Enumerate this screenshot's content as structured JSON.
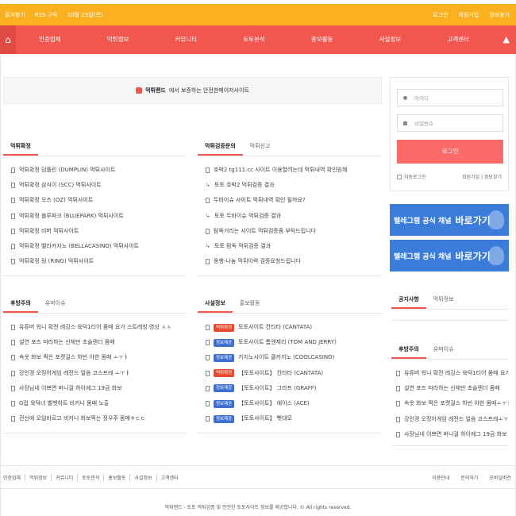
{
  "topbar": {
    "left": [
      "즐겨찾기",
      "RSS 구독",
      "10월 23일(목)"
    ],
    "right": [
      "로그인",
      "회원가입",
      "정보찾기"
    ]
  },
  "nav": {
    "items": [
      "인증업체",
      "먹튀정보",
      "커뮤니티",
      "토토분석",
      "홍보활동",
      "사설정보",
      "고객센터"
    ]
  },
  "banner": {
    "brand": "먹튀랜드",
    "text": "에서 보증하는 안전한메이저사이트"
  },
  "box1": {
    "tabs": [
      "먹튀확정"
    ],
    "items": [
      "먹튀확정 덤플린 (DUMPLIN) 먹튀사이트",
      "먹튀확정 삼식이 (SCC) 먹튀사이트",
      "먹튀확정 오즈 (OZ) 먹튀사이트",
      "먹튀확정 블루파크 (BLUEPARK) 먹튀사이트",
      "먹튀확정 비버 먹튀사이트",
      "먹튀확정 벨라카지노 (BELLACASINO) 먹튀사이트",
      "먹튀확정 링 (RING) 먹튀사이트"
    ]
  },
  "box2": {
    "tabs": [
      "먹튀검증문의",
      "먹튀신고"
    ],
    "items": [
      "호박2 tg111.cc 사이트 이용할려는데 먹튀내역 확인원해",
      "토토 호박2 먹튀검증 결과",
      "두바이슈 사이트 먹튀내역 확인 될까요?",
      "토토 두바이슈 먹튀검증 결과",
      "탐독거리는 사이트 먹튀검증좀 부탁드립니다",
      "토토 탐독 먹튀검증 결과",
      "동행-나눔 먹튀이력 검증요청드립니다"
    ]
  },
  "box3": {
    "tabs": [
      "후방주의",
      "유머이슈"
    ],
    "items": [
      "유튜버 워니 확전 레깅스 육덕1티어 몸매 요가 스트레칭 영상 ㅅㅅ",
      "설연 포즈 따라하는 신체만 초슬렌더 몸매",
      "속옷 화보 찍은 포켓걸스 하빈 야한 몸매 ㅗㅜㅑ",
      "강인경 오징어게임 레전드 얼음 코스프레 ㅗㅜㅑ",
      "사장님네 이쁘면 버니걸 하이에그 19금 화보",
      "G컵 육덕녀 벨벳하트 비키니 몸매 노출",
      "전신에 오일바르고 비키니 화보찍는 정우주 몸매ㅎㄷㄷ"
    ]
  },
  "box4": {
    "tabs": [
      "사설정보",
      "홍보활동"
    ],
    "items": [
      {
        "badge": "먹튀확정",
        "color": "red",
        "text": "토토사이트 칸타타 (CANTATA)"
      },
      {
        "badge": "정보제공",
        "color": "blue",
        "text": "토토사이트 톰앤제리 (TOM AND JERRY)"
      },
      {
        "badge": "정보제공",
        "color": "blue",
        "text": "카지노사이트 쿨카지노 (COOLCASINO)"
      },
      {
        "badge": "먹튀확정",
        "color": "red",
        "text": "【토토사이트】 칸타타 (CANTATA)"
      },
      {
        "badge": "정보제공",
        "color": "blue",
        "text": "【토토사이트】 그라프 (GRAFF)"
      },
      {
        "badge": "정보제공",
        "color": "blue",
        "text": "【토토사이트】 에이스 (ACE)"
      },
      {
        "badge": "정보제공",
        "color": "blue",
        "text": "【토토사이트】 뻣대모"
      }
    ]
  },
  "login": {
    "id_placeholder": "아이디",
    "pw_placeholder": "비밀번호",
    "button": "로그인",
    "auto": "자동로그인",
    "links": "회원가입 | 정보찾기"
  },
  "telegram": {
    "label": "텔레그램 공식 채널",
    "cta": "바로가기"
  },
  "box5": {
    "tabs": [
      "공지사항",
      "먹튀정보"
    ]
  },
  "box6": {
    "tabs": [
      "후방주의",
      "유머이슈"
    ],
    "items": [
      "유튜버 워니 확전 레깅스 육덕1티어 몸매 요가 스...",
      "설연 포즈 따라하는 신체만 초슬렌더 몸매",
      "속옷 화보 찍은 포켓걸스 하빈 야한 몸매ㅗㅜㅑ",
      "강인경 오징어게임 레전드 얼음 코스프레ㅗㅜㅑ",
      "사장님네 이쁘면 버니걸 하이에그 19금 화보"
    ]
  },
  "footer": {
    "links": [
      "인증업체",
      "먹튀정보",
      "커뮤니티",
      "토토분석",
      "홍보활동",
      "사설정보",
      "고객센터"
    ],
    "right": [
      "이용안내",
      "문의하기",
      "모바일버전"
    ],
    "copyright": "먹튀랜드 - 토토 먹튀검증 및 안전한 토토사이트 정보를 제공합니다. © All rights reserved."
  }
}
